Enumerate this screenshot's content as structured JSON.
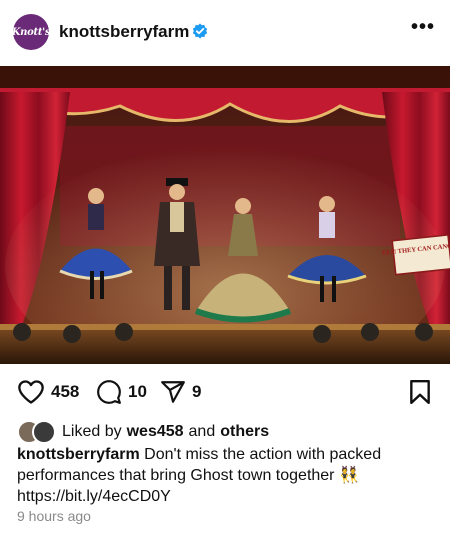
{
  "post": {
    "username": "knottsberryfarm",
    "avatar_text": "Knott's",
    "verified_icon": "verified-badge-icon",
    "more_icon": "more-options-icon",
    "image_sign_text": "YES! THEY CAN CANCAN",
    "likes_count": "458",
    "comments_count": "10",
    "shares_count": "9",
    "liked_prefix": "Liked by",
    "liked_user": "wes458",
    "liked_and": "and",
    "liked_others": "others",
    "caption_user": "knottsberryfarm",
    "caption_text": "Don't miss the action with packed performances that bring Ghost town together 👯",
    "caption_link": "https://bit.ly/4ecCD0Y",
    "timestamp": "9 hours ago"
  },
  "colors": {
    "brand_purple": "#6b2a78",
    "verified_blue": "#1d9bf0",
    "curtain_red": "#b3122a",
    "muted_text": "#8a8a8a"
  }
}
